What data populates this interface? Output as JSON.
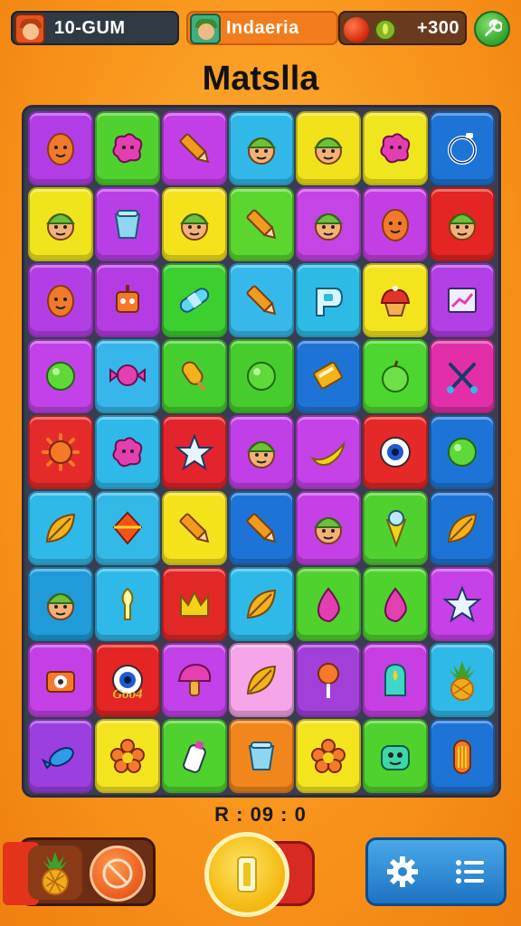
{
  "header": {
    "player_label": "10-GUM",
    "player_icon": "avatar-icon",
    "region_label": "Indaeria",
    "region_icon": "avatar-icon",
    "score_label": "+300",
    "resource_icons": [
      "apple-icon",
      "coin-icon"
    ],
    "tool_icon": "wrench-icon"
  },
  "title": "Matslla",
  "board": {
    "rows": 9,
    "cols": 7,
    "tiles": [
      [
        {
          "color": "#b23de6",
          "icon": "egg-icon"
        },
        {
          "color": "#4fd12e",
          "icon": "blob-icon"
        },
        {
          "color": "#c23fe8",
          "icon": "crayon-icon"
        },
        {
          "color": "#2fb8e8",
          "icon": "face-icon"
        },
        {
          "color": "#f2e21a",
          "icon": "face-icon"
        },
        {
          "color": "#f0e61d",
          "icon": "blob-icon"
        },
        {
          "color": "#1e74d6",
          "icon": "ring-icon"
        }
      ],
      [
        {
          "color": "#f0e51c",
          "icon": "face-icon"
        },
        {
          "color": "#b83fe6",
          "icon": "cup-icon"
        },
        {
          "color": "#f5e21b",
          "icon": "face-icon"
        },
        {
          "color": "#5bd62f",
          "icon": "crayon-icon"
        },
        {
          "color": "#c544e6",
          "icon": "face-icon"
        },
        {
          "color": "#c43fe3",
          "icon": "egg-icon"
        },
        {
          "color": "#e52424",
          "icon": "face-icon"
        }
      ],
      [
        {
          "color": "#b43ee6",
          "icon": "egg-icon"
        },
        {
          "color": "#b53be3",
          "icon": "robot-icon"
        },
        {
          "color": "#3ccf30",
          "icon": "bandage-icon"
        },
        {
          "color": "#36b9ea",
          "icon": "crayon-icon"
        },
        {
          "color": "#2dbbe6",
          "icon": "p-icon"
        },
        {
          "color": "#f4e41e",
          "icon": "cupcake-icon"
        },
        {
          "color": "#b33fe6",
          "icon": "chart-icon"
        }
      ],
      [
        {
          "color": "#c241e8",
          "icon": "ball-icon"
        },
        {
          "color": "#36b6ea",
          "icon": "candy-icon"
        },
        {
          "color": "#44cf2f",
          "icon": "popsicle-icon"
        },
        {
          "color": "#47cc2e",
          "icon": "ball-icon"
        },
        {
          "color": "#1e74d6",
          "icon": "card-icon"
        },
        {
          "color": "#4cd62f",
          "icon": "apple-icon"
        },
        {
          "color": "#e22fa9",
          "icon": "scissors-icon"
        }
      ],
      [
        {
          "color": "#e52a2a",
          "icon": "sun-icon"
        },
        {
          "color": "#2fb9e8",
          "icon": "blob-icon"
        },
        {
          "color": "#e3242c",
          "icon": "star-icon"
        },
        {
          "color": "#c03fe6",
          "icon": "face-icon"
        },
        {
          "color": "#c541e8",
          "icon": "banana-icon"
        },
        {
          "color": "#e52828",
          "icon": "eye-icon"
        },
        {
          "color": "#1e74d6",
          "icon": "ball-icon"
        }
      ],
      [
        {
          "color": "#2fb9e8",
          "icon": "leaf-icon"
        },
        {
          "color": "#33b9e8",
          "icon": "gem-icon"
        },
        {
          "color": "#f4e21b",
          "icon": "crayon-icon"
        },
        {
          "color": "#1e74d6",
          "icon": "crayon-icon"
        },
        {
          "color": "#c540e6",
          "icon": "face-icon"
        },
        {
          "color": "#50d12f",
          "icon": "cone-icon"
        },
        {
          "color": "#1e74d6",
          "icon": "leaf-icon"
        }
      ],
      [
        {
          "color": "#1f9bd9",
          "icon": "face-icon"
        },
        {
          "color": "#2fb9e8",
          "icon": "bulb-icon"
        },
        {
          "color": "#e32828",
          "icon": "crown-icon"
        },
        {
          "color": "#2fb9e8",
          "icon": "leaf-icon"
        },
        {
          "color": "#4fd12e",
          "icon": "drop-icon"
        },
        {
          "color": "#4fd12e",
          "icon": "drop-icon"
        },
        {
          "color": "#c641e8",
          "icon": "star-icon"
        }
      ],
      [
        {
          "color": "#c440e6",
          "icon": "camera-icon"
        },
        {
          "color": "#e52424",
          "icon": "eye-icon",
          "caption": "Goo4"
        },
        {
          "color": "#c241e8",
          "icon": "mushroom-icon"
        },
        {
          "color": "#f5a5e8",
          "icon": "leaf-icon"
        },
        {
          "color": "#a13fd8",
          "icon": "lollipop-icon"
        },
        {
          "color": "#c73fe3",
          "icon": "jar-icon"
        },
        {
          "color": "#2fb9e8",
          "icon": "pineapple-icon"
        }
      ],
      [
        {
          "color": "#9c3fe0",
          "icon": "fish-icon"
        },
        {
          "color": "#f4e41e",
          "icon": "flower-icon"
        },
        {
          "color": "#4fd12e",
          "icon": "bottle-icon"
        },
        {
          "color": "#f0861c",
          "icon": "cup-icon"
        },
        {
          "color": "#f4e41e",
          "icon": "flower-icon"
        },
        {
          "color": "#4fd12e",
          "icon": "monster-icon"
        },
        {
          "color": "#1e74d6",
          "icon": "pill-icon"
        }
      ]
    ]
  },
  "timer": "R : 09 : 0",
  "footer": {
    "left_icons": [
      "pineapple-icon",
      "cancel-icon"
    ],
    "center_icon": "pause-icon",
    "right_icons": [
      "gear-icon",
      "menu-icon"
    ]
  }
}
